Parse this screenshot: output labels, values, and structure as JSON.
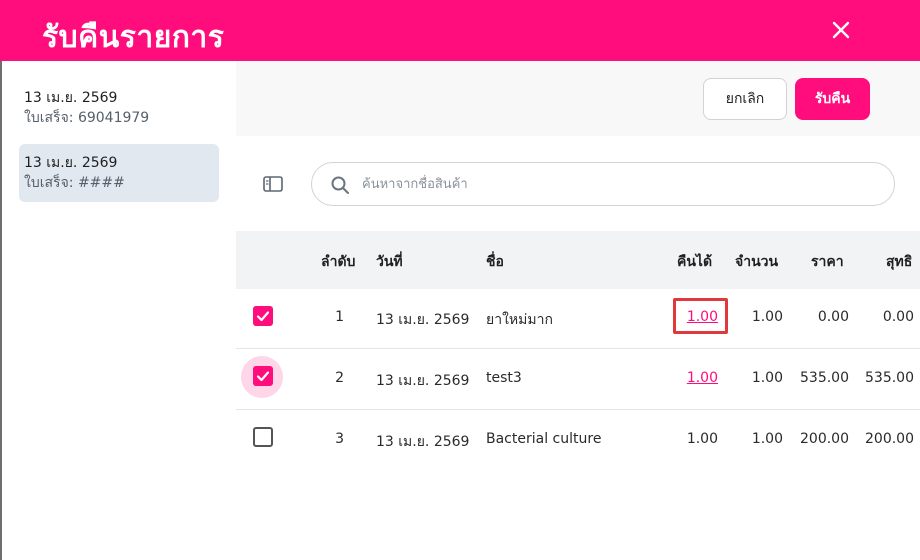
{
  "dialog": {
    "title": "รับคืนรายการ",
    "close_icon": "close-icon"
  },
  "colors": {
    "brand": "#ff0c7d",
    "highlight": "#e0393b"
  },
  "sidebar": {
    "receipts": [
      {
        "date": "13 เม.ย. 2569",
        "code": "ใบเสร็จ: 69041979",
        "selected": false
      },
      {
        "date": "13 เม.ย. 2569",
        "code": "ใบเสร็จ: ####",
        "selected": true
      }
    ]
  },
  "toolbar": {
    "cancel_label": "ยกเลิก",
    "return_label": "รับคืน"
  },
  "search": {
    "placeholder": "ค้นหาจากชื่อสินค้า",
    "value": ""
  },
  "table": {
    "headers": {
      "seq": "ลำดับ",
      "date": "วันที่",
      "name": "ชื่อ",
      "returnable": "คืนได้",
      "qty": "จำนวน",
      "price": "ราคา",
      "net": "สุทธิ"
    },
    "rows": [
      {
        "checked": true,
        "seq": "1",
        "date": "13 เม.ย. 2569",
        "name": "ยาใหม่มาก",
        "returnable": "1.00",
        "qty": "1.00",
        "price": "0.00",
        "net": "0.00"
      },
      {
        "checked": true,
        "seq": "2",
        "date": "13 เม.ย. 2569",
        "name": "test3",
        "returnable": "1.00",
        "qty": "1.00",
        "price": "535.00",
        "net": "535.00"
      },
      {
        "checked": false,
        "seq": "3",
        "date": "13 เม.ย. 2569",
        "name": "Bacterial culture",
        "returnable": "1.00",
        "qty": "1.00",
        "price": "200.00",
        "net": "200.00"
      }
    ]
  }
}
